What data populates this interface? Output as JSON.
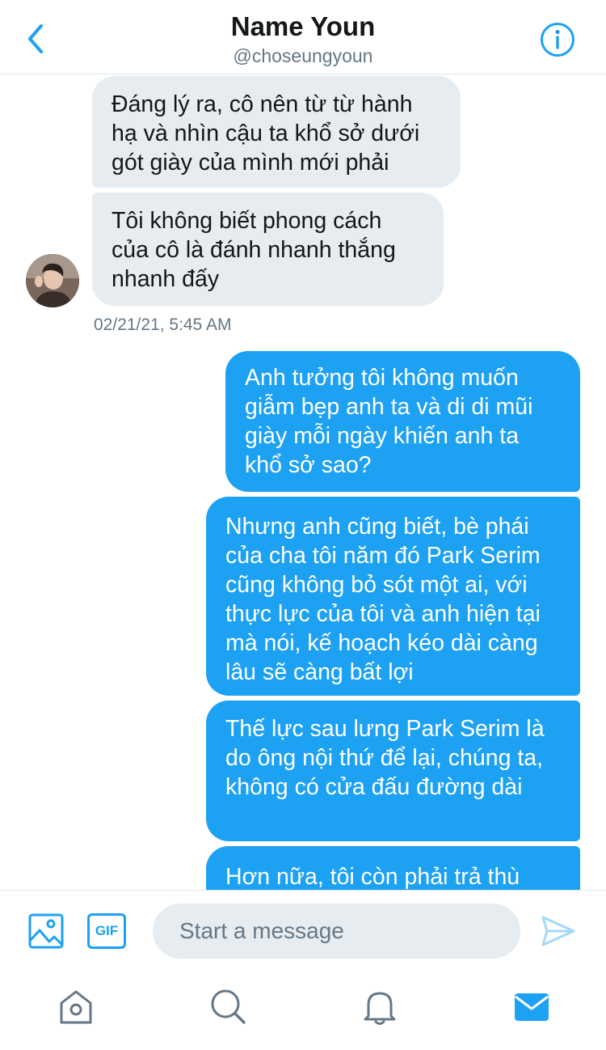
{
  "header": {
    "title": "Name Youn",
    "handle": "@choseungyoun"
  },
  "messages": [
    {
      "direction": "in",
      "text": "Đáng lý ra, cô nên từ từ hành hạ và nhìn cậu ta khổ sở dưới gót giày của mình mới phải"
    },
    {
      "direction": "in",
      "text": "Tôi không biết phong cách của cô là đánh nhanh thắng nhanh đấy"
    },
    {
      "direction": "out",
      "text": "Anh tưởng tôi không muốn giẫm bẹp anh ta và di di mũi giày mỗi ngày khiến anh ta khổ sở sao?"
    },
    {
      "direction": "out",
      "text": "Nhưng anh cũng biết, bè phái của cha tôi năm đó Park Serim cũng không bỏ sót một ai, với thực lực của tôi và anh hiện tại mà nói, kế hoạch kéo dài càng lâu sẽ càng bất lợi"
    },
    {
      "direction": "out",
      "text": "Thế lực sau lưng Park Serim là do ông nội thứ để lại, chúng ta, không có cửa đấu đường dài"
    },
    {
      "direction": "out",
      "text": "Hơn nữa, tôi còn phải trả thù"
    }
  ],
  "timestamp": "02/21/21, 5:45 AM",
  "composer": {
    "placeholder": "Start a message",
    "gif_label": "GIF"
  },
  "icons": {
    "back": "chevron-left-icon",
    "info": "info-icon",
    "media": "image-icon",
    "send": "send-icon",
    "home": "home-icon",
    "search": "search-icon",
    "notifications": "bell-icon",
    "messages": "mail-icon"
  },
  "colors": {
    "accent": "#1da1f2",
    "incoming_bubble": "#e6ecf0",
    "secondary_text": "#657786",
    "inactive_icon": "#657786"
  }
}
